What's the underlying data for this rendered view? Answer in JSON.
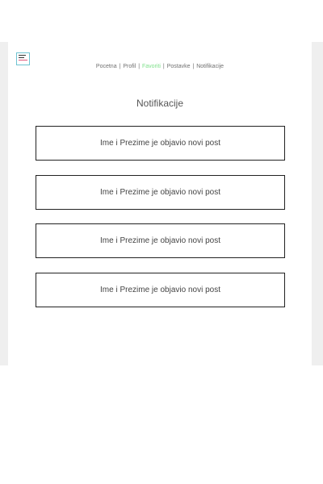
{
  "nav": {
    "items": [
      {
        "label": "Pocetna"
      },
      {
        "label": "Profil"
      },
      {
        "label": "Favoriti"
      },
      {
        "label": "Postavke"
      },
      {
        "label": "Notifikacije"
      }
    ],
    "separator": "|",
    "active_color": "#7ee08a"
  },
  "page": {
    "title": "Notifikacije"
  },
  "notifications": [
    {
      "text": "Ime i Prezime je objavio novi post"
    },
    {
      "text": "Ime i Prezime je objavio novi post"
    },
    {
      "text": "Ime i Prezime je objavio novi post"
    },
    {
      "text": "Ime i Prezime je objavio novi post"
    }
  ]
}
